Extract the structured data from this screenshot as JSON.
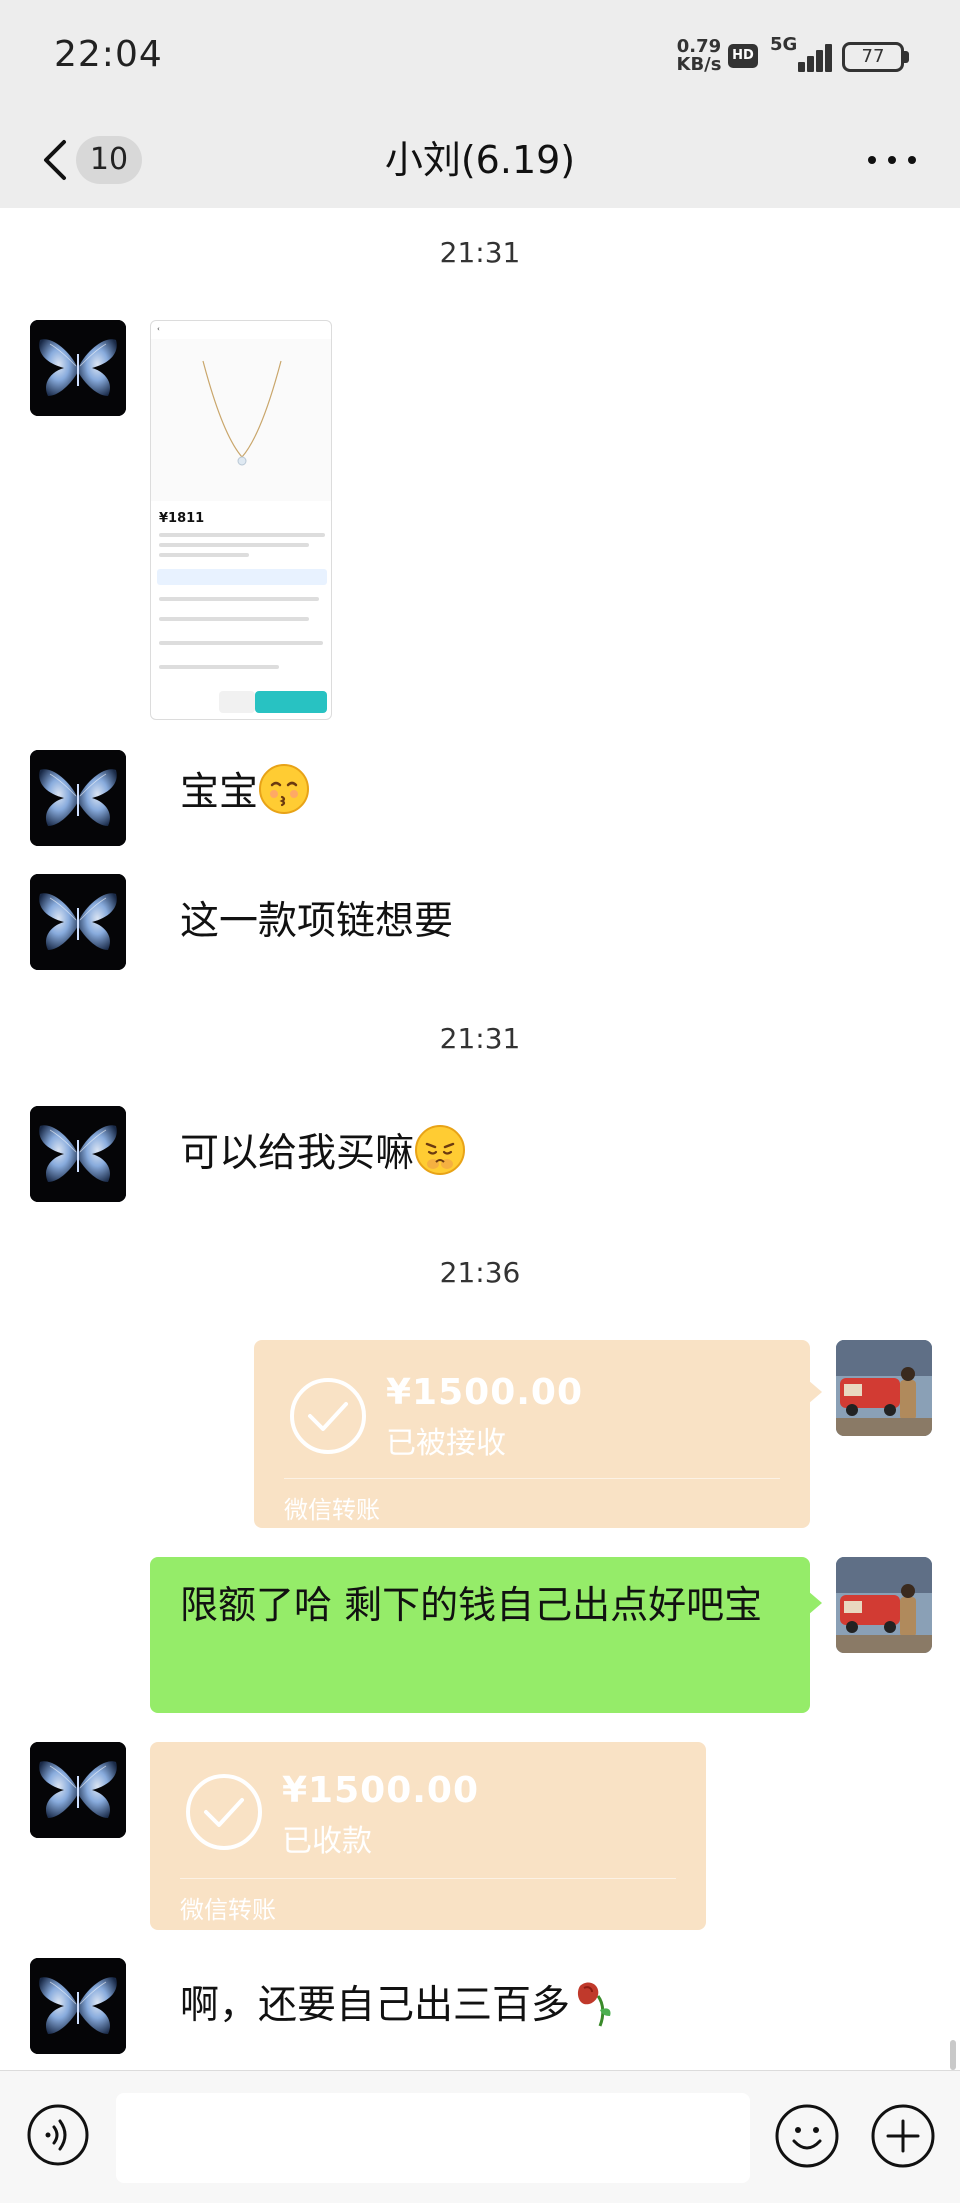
{
  "status_bar": {
    "time": "22:04",
    "net_speed_value": "0.79",
    "net_speed_unit": "KB/s",
    "hd": "HD",
    "network": "5G",
    "battery": "77"
  },
  "nav": {
    "unread_count": "10",
    "title": "小刘(6.19)"
  },
  "messages": {
    "ts1": "21:31",
    "shot_price": "¥1811",
    "msg1": "宝宝",
    "msg2": "这一款项链想要",
    "ts2": "21:31",
    "msg3": "可以给我买嘛",
    "ts3": "21:36",
    "transfer1": {
      "amount": "¥1500.00",
      "status": "已被接收",
      "brand": "微信转账"
    },
    "green_msg": "限额了哈 剩下的钱自己出点好吧宝",
    "transfer2": {
      "amount": "¥1500.00",
      "status": "已收款",
      "brand": "微信转账"
    },
    "msg4": "啊，还要自己出三百多"
  },
  "colors": {
    "sent_bubble": "#95ec69",
    "transfer_card": "#f9e2c5",
    "background": "#ffffff",
    "header": "#ededed"
  },
  "icons": [
    "back-arrow-icon",
    "more-icon",
    "voice-icon",
    "emoji-icon",
    "plus-icon",
    "check-icon",
    "butterfly-avatar",
    "wilted-rose-emoji",
    "kiss-emoji",
    "pleading-emoji"
  ]
}
